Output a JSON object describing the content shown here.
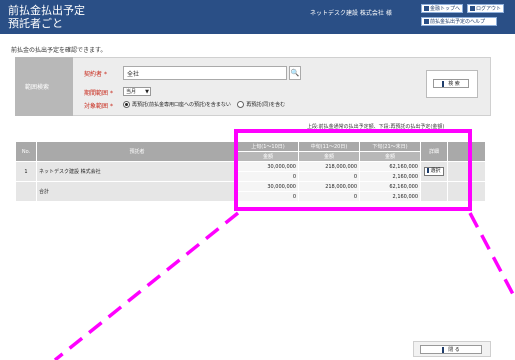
{
  "header": {
    "title_line1": "前払金払出予定",
    "title_line2": "預託者ごと",
    "company": "ネットデスク建設 株式会社 様",
    "buttons": {
      "home": "金融トップへ",
      "logout": "ログアウト",
      "help": "前払金払出予定のヘルプ"
    }
  },
  "intro_text": "前払金の払出予定を確認できます。",
  "search": {
    "section_label": "範囲検索",
    "company_label": "契約者",
    "company_required_mark": "*",
    "company_value": "全社",
    "period_label": "期間範囲",
    "period_required_mark": "*",
    "period_value": "当月",
    "target_label": "対象範囲",
    "target_required_mark": "*",
    "radio_option1": "再預託(前払金専用口座への預託)を含まない",
    "radio_option2": "再預託(同)を含む",
    "search_button": "検 索"
  },
  "table": {
    "caption": "上段:前払金通常の払出予定額、下段:再預託の払出予定(金額)",
    "headers": {
      "no": "No.",
      "name": "預託者",
      "period1": "上旬(1～10日)",
      "period2": "中旬(11～20日)",
      "period3": "下旬(21～末日)",
      "detail": "詳細",
      "amount": "金額"
    },
    "rows": [
      {
        "no": "1",
        "name": "ネットデスク建設 株式会社",
        "p1_top": "30,000,000",
        "p1_bottom": "0",
        "p2_top": "218,000,000",
        "p2_bottom": "0",
        "p3_top": "62,160,000",
        "p3_bottom": "2,160,000",
        "detail_button": "選択"
      }
    ],
    "total": {
      "label": "合計",
      "p1_top": "30,000,000",
      "p1_bottom": "0",
      "p2_top": "218,000,000",
      "p2_bottom": "0",
      "p3_top": "62,160,000",
      "p3_bottom": "2,160,000"
    }
  },
  "close_button": "閉 る",
  "highlight_color": "#ff00ff",
  "header_color": "#2a4f86"
}
